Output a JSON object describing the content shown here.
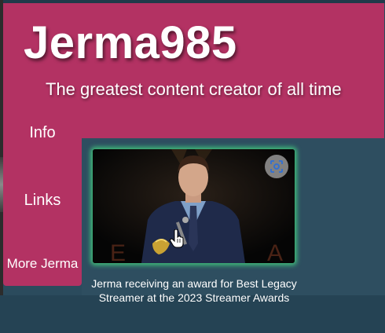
{
  "header": {
    "title": "Jerma985",
    "tagline": "The greatest content creator of all time"
  },
  "nav": {
    "items": [
      {
        "label": "Info"
      },
      {
        "label": "Links"
      },
      {
        "label": "More Jerma"
      }
    ]
  },
  "figure": {
    "caption": "Jerma receiving an award for Best Legacy Streamer at the 2023 Streamer Awards",
    "lens_icon": "google-lens-icon"
  },
  "colors": {
    "header_bg": "#b33263",
    "page_bg": "#2b4b5d",
    "figure_glow": "#3fb879"
  }
}
